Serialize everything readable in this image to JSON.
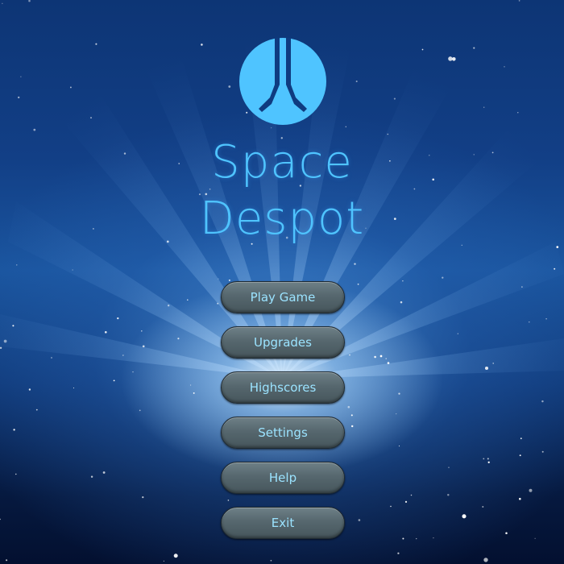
{
  "game": {
    "title_line_1": "Space",
    "title_line_2": "Despot"
  },
  "menu": {
    "items": [
      {
        "id": "play",
        "label": "Play Game"
      },
      {
        "id": "upgrades",
        "label": "Upgrades"
      },
      {
        "id": "highscores",
        "label": "Highscores"
      },
      {
        "id": "settings",
        "label": "Settings"
      },
      {
        "id": "help",
        "label": "Help"
      },
      {
        "id": "exit",
        "label": "Exit"
      }
    ]
  },
  "colors": {
    "title": "#4fc4ff",
    "logo": "#4fc4ff",
    "button_text": "#9be3ff",
    "button_fill": "#56676e"
  },
  "icons": {
    "logo": "emblem-icon"
  }
}
